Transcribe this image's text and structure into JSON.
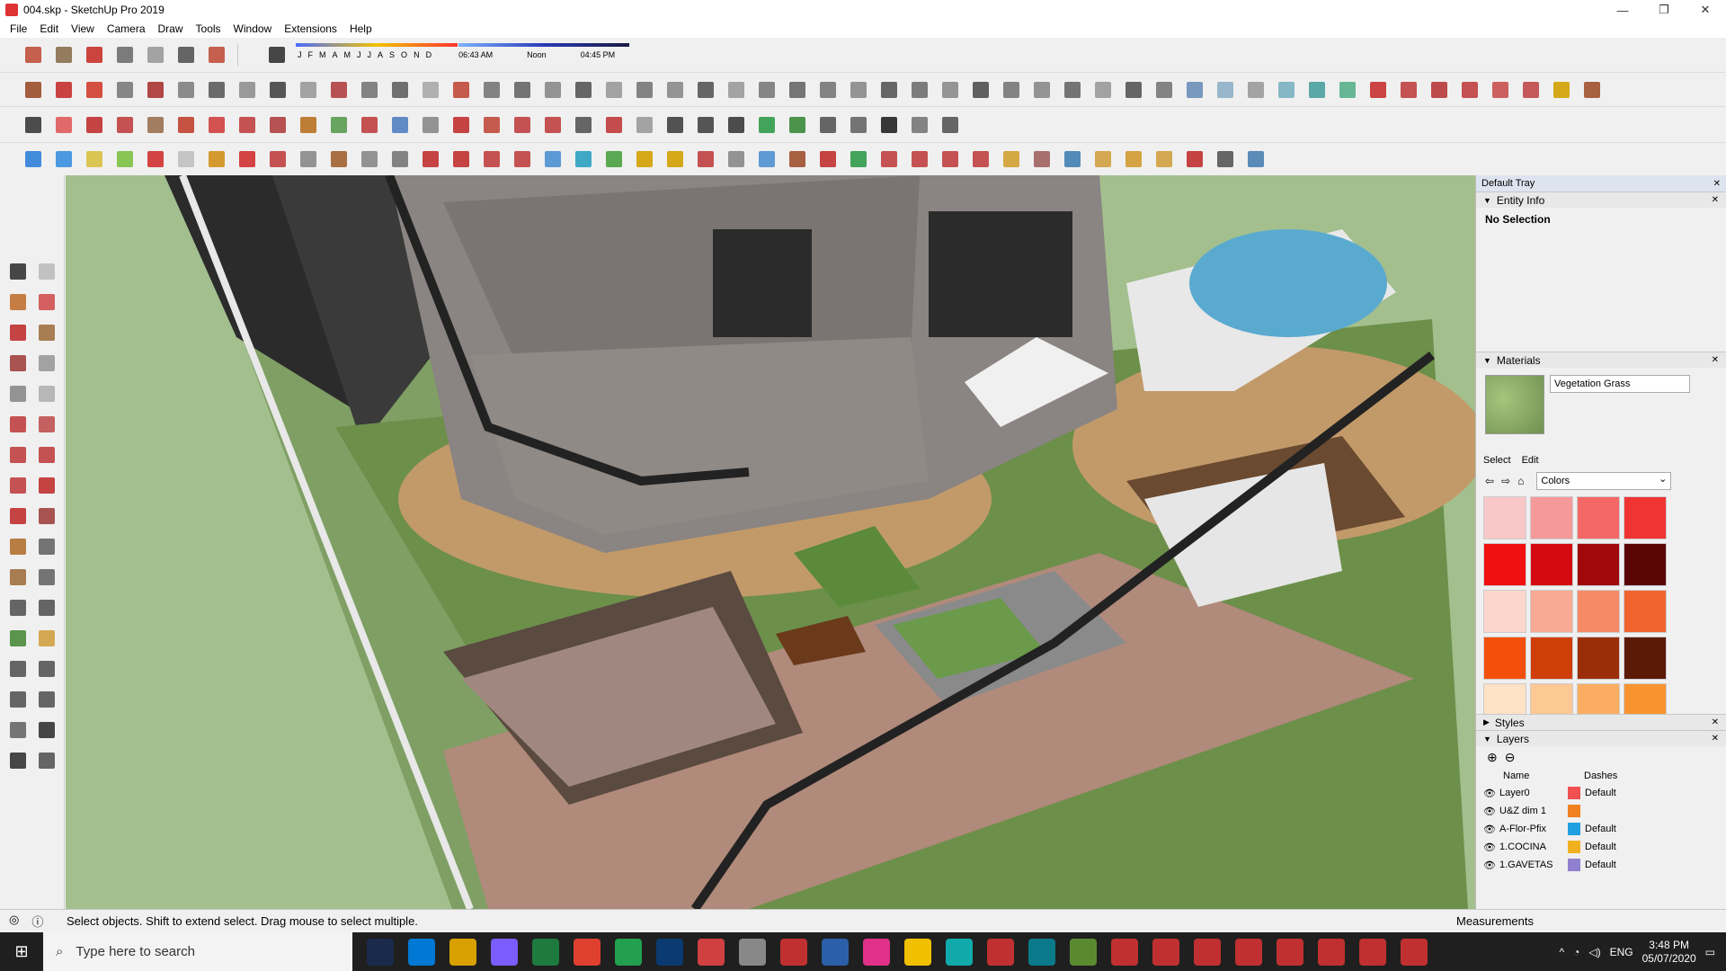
{
  "window": {
    "title": "004.skp - SketchUp Pro 2019",
    "controls": [
      "—",
      "❐",
      "✕"
    ]
  },
  "menu": [
    "File",
    "Edit",
    "View",
    "Camera",
    "Draw",
    "Tools",
    "Window",
    "Extensions",
    "Help"
  ],
  "shadow": {
    "months": [
      "J",
      "F",
      "M",
      "A",
      "M",
      "J",
      "J",
      "A",
      "S",
      "O",
      "N",
      "D"
    ],
    "times": [
      "06:43 AM",
      "Noon",
      "04:45 PM"
    ]
  },
  "toolbar_colors": {
    "row1": [
      "#c0503c",
      "#8a6f4e",
      "#c9312a",
      "#6e6e6e",
      "#9a9a9a",
      "#555555",
      "#c0503c"
    ],
    "row2": [
      "#9a4b2a",
      "#c43030",
      "#d23d2d",
      "#7a7a7a",
      "#a33",
      "#7f7f7f",
      "#5b5b5b",
      "#8f8f8f",
      "#444",
      "#999",
      "#b04040",
      "#777",
      "#606060",
      "#a8a8a8",
      "#c04a3a",
      "#777",
      "#666",
      "#888",
      "#555",
      "#999",
      "#777",
      "#8a8a8a",
      "#555",
      "#9a9a9a",
      "#7a7a7a",
      "#676767",
      "#777",
      "#8a8a8a",
      "#565656",
      "#6f6f6f",
      "#8b8b8b",
      "#4f4f4f",
      "#777",
      "#888",
      "#666",
      "#999",
      "#555",
      "#777",
      "#6a8fb8",
      "#8fb0c8",
      "#9a9a9a",
      "#7ab0c0",
      "#4aa0a0",
      "#58b08a",
      "#c83030",
      "#c04040",
      "#b83838",
      "#c04040",
      "#c85050",
      "#c04848",
      "#d0a000",
      "#a05030"
    ],
    "row3": [
      "#3a3a3a",
      "#e05a5a",
      "#c03030",
      "#c04040",
      "#9a7050",
      "#c04030",
      "#d04040",
      "#c04040",
      "#b04040",
      "#b87020",
      "#5a9a50",
      "#c04040",
      "#5080c0",
      "#888",
      "#c03030",
      "#c04a3a",
      "#c04040",
      "#c04040",
      "#555",
      "#c03a3a",
      "#9a9a9a",
      "#404040",
      "#444",
      "#3a3a3a",
      "#2f9a4a",
      "#3a8a3a",
      "#555",
      "#666",
      "#222",
      "#777",
      "#555"
    ],
    "row4": [
      "#2f7fd8",
      "#3a8fe0",
      "#d8c040",
      "#7cc040",
      "#d03030",
      "#c0c0c0",
      "#d0901a",
      "#d03030",
      "#c04040",
      "#888",
      "#a06030",
      "#888",
      "#777",
      "#c03030",
      "#c03030",
      "#c04040",
      "#c04040",
      "#4a90d0",
      "#2aa0c0",
      "#4aa040",
      "#d0a000",
      "#d0a000",
      "#c04040",
      "#888",
      "#5090d0",
      "#a05030",
      "#c03030",
      "#2f9a4a",
      "#c04040",
      "#c04040",
      "#c04040",
      "#c04040",
      "#d0a030",
      "#a06060",
      "#4080b0",
      "#d0a040",
      "#d09a30",
      "#d0a040",
      "#c03030",
      "#555",
      "#4a80b0"
    ],
    "left": [
      "#333",
      "#bbb",
      "#c07030",
      "#d05050",
      "#c03030",
      "#a07040",
      "#a04040",
      "#999",
      "#888",
      "#b0b0b0",
      "#c04040",
      "#c05050",
      "#c04040",
      "#c04040",
      "#c04040",
      "#c03030",
      "#c03030",
      "#a04040",
      "#b07030",
      "#666",
      "#a07040",
      "#666",
      "#555",
      "#555",
      "#4a8a3a",
      "#d0a040",
      "#555",
      "#555",
      "#555",
      "#555",
      "#666",
      "#333",
      "#333",
      "#555"
    ]
  },
  "tray": {
    "title": "Default Tray",
    "entity_info": {
      "header": "Entity Info",
      "selection": "No Selection"
    },
    "materials": {
      "header": "Materials",
      "name": "Vegetation Grass",
      "tabs": [
        "Select",
        "Edit"
      ],
      "library": "Colors",
      "swatches": [
        "#f8c8c8",
        "#f59a9a",
        "#f56868",
        "#f03434",
        "#f01010",
        "#d40a10",
        "#a0080c",
        "#5a0506",
        "#fcd6cc",
        "#f9aa94",
        "#f78a66",
        "#f2642e",
        "#f2500a",
        "#d03e08",
        "#9a2e08",
        "#5a1a06",
        "#fde2c6",
        "#fcc894",
        "#fbae62",
        "#f79430"
      ]
    },
    "styles": {
      "header": "Styles"
    },
    "layers": {
      "header": "Layers",
      "columns": [
        "Name",
        "Dashes"
      ],
      "rows": [
        {
          "name": "Layer0",
          "color": "#f05050",
          "dashes": "Default"
        },
        {
          "name": "U&Z dim 1",
          "color": "#f08020",
          "dashes": ""
        },
        {
          "name": "A-Flor-Pfix",
          "color": "#20a0e0",
          "dashes": "Default"
        },
        {
          "name": "1.COCINA",
          "color": "#f0b020",
          "dashes": "Default"
        },
        {
          "name": "1.GAVETAS",
          "color": "#9080d0",
          "dashes": "Default"
        }
      ]
    }
  },
  "status": {
    "hint": "Select objects. Shift to extend select. Drag mouse to select multiple.",
    "measurements": "Measurements"
  },
  "taskbar": {
    "search_placeholder": "Type here to search",
    "language": "ENG",
    "time": "3:48 PM",
    "date": "05/07/2020",
    "apps": [
      "#1a2a4a",
      "#0078d4",
      "#d8a000",
      "#7a5cff",
      "#1e7a3e",
      "#e04030",
      "#22a050",
      "#0a3a70",
      "#d04040",
      "#888",
      "#c03030",
      "#2b5fa8",
      "#e0308a",
      "#f0c000",
      "#1aa",
      "#c03030",
      "#0a7a8a",
      "#5a8a30",
      "#c03030",
      "#c03030",
      "#c03030",
      "#c03030",
      "#c03030",
      "#c03030",
      "#c03030",
      "#c03030"
    ]
  }
}
